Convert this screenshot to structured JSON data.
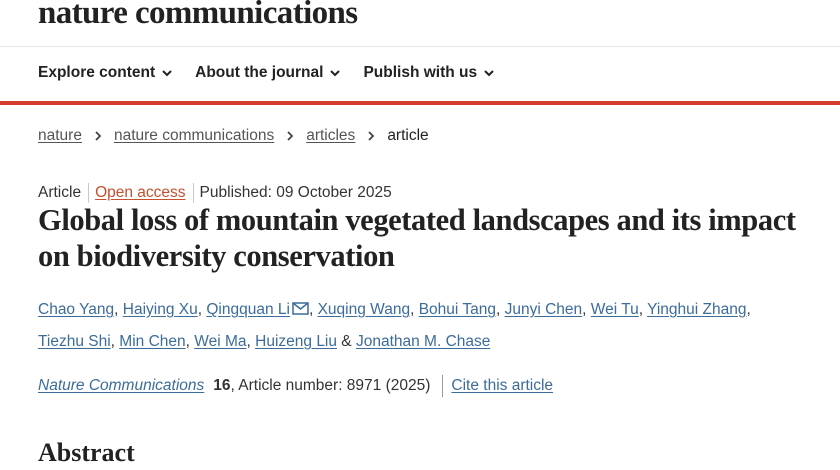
{
  "header": {
    "logo": "nature communications",
    "nav": [
      {
        "label": "Explore content"
      },
      {
        "label": "About the journal"
      },
      {
        "label": "Publish with us"
      }
    ]
  },
  "breadcrumb": {
    "items": [
      "nature",
      "nature communications",
      "articles"
    ],
    "current": "article"
  },
  "article": {
    "type": "Article",
    "access": "Open access",
    "published": "Published: 09 October 2025",
    "title": "Global loss of mountain vegetated landscapes and its impact on biodiversity conservation",
    "authors_line1": [
      "Chao Yang",
      "Haiying Xu",
      "Qingquan Li",
      "Xuqing Wang",
      "Bohui Tang",
      "Junyi Chen",
      "Wei Tu",
      "Yinghui Zhang"
    ],
    "authors_line2": [
      "Tiezhu Shi",
      "Min Chen",
      "Wei Ma",
      "Huizeng Liu"
    ],
    "last_author": "Jonathan M. Chase",
    "author_separator": ", ",
    "final_separator": " & ",
    "corresponding_icon": "mail-icon",
    "journal": "Nature Communications",
    "volume": "16",
    "article_number": ", Article number: 8971 (2025)",
    "cite_label": "Cite this article",
    "abstract_heading": "Abstract"
  },
  "colors": {
    "accent_red": "#d63b2f",
    "link_blue": "#3c6c9a",
    "open_access": "#c4502f"
  }
}
